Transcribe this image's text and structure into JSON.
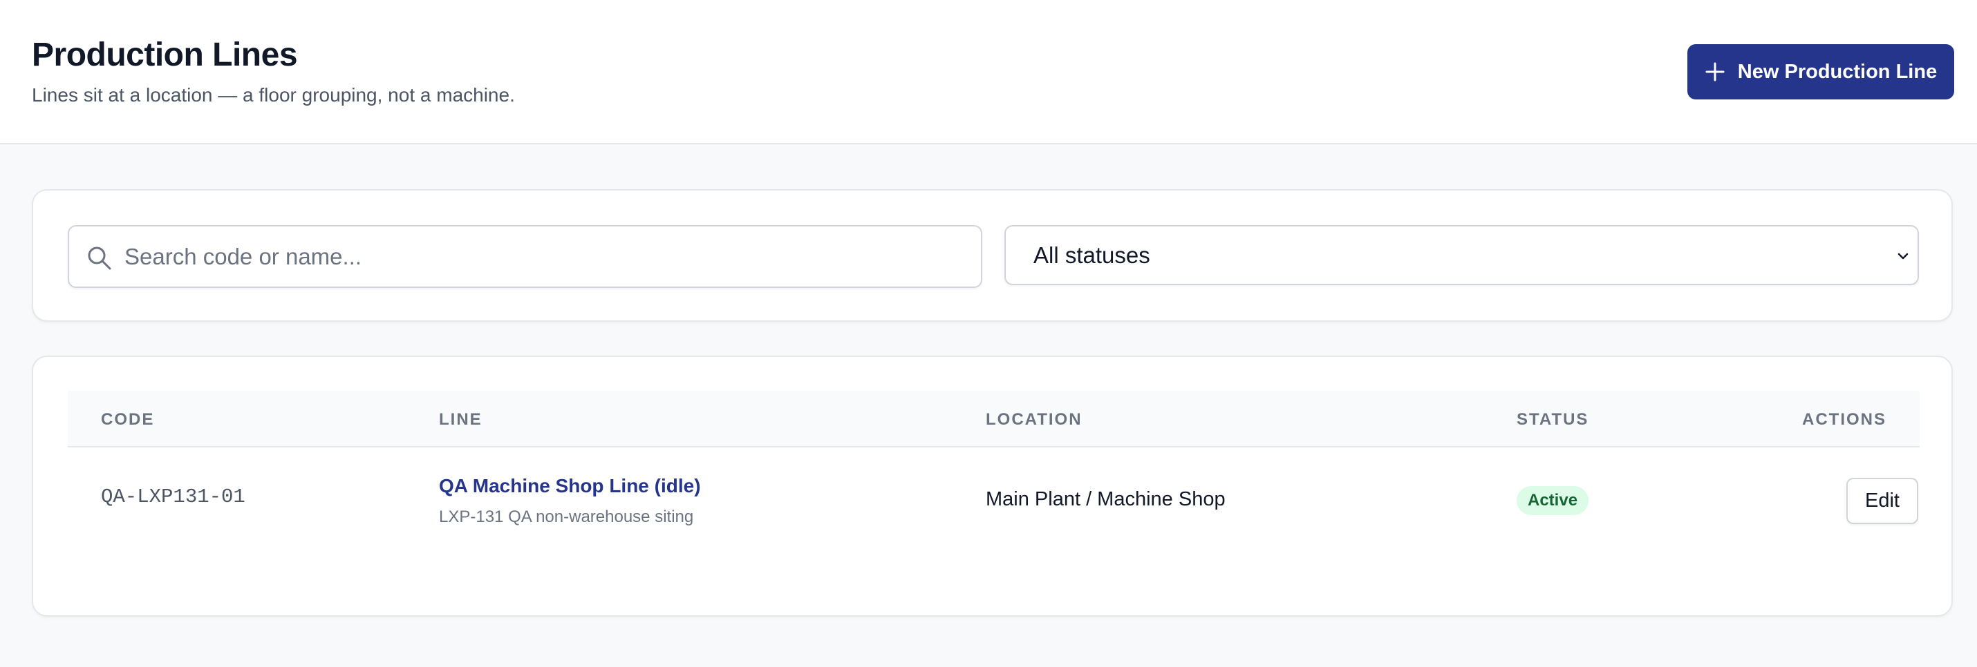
{
  "header": {
    "title": "Production Lines",
    "subtitle": "Lines sit at a location — a floor grouping, not a machine.",
    "new_button_label": "New Production Line",
    "new_button_icon": "plus-icon"
  },
  "filters": {
    "search": {
      "placeholder": "Search code or name...",
      "value": "",
      "icon": "search-icon"
    },
    "status_select": {
      "selected": "All statuses",
      "icon": "chevron-down-icon"
    }
  },
  "table": {
    "columns": [
      "CODE",
      "LINE",
      "LOCATION",
      "STATUS",
      "ACTIONS"
    ],
    "rows": [
      {
        "code": "QA-LXP131-01",
        "line_name": "QA Machine Shop Line (idle)",
        "line_description": "LXP-131 QA non-warehouse siting",
        "location": "Main Plant / Machine Shop",
        "status": "Active",
        "action_label": "Edit"
      }
    ]
  },
  "colors": {
    "primary": "#26358c",
    "active_badge_bg": "#dcfce7",
    "active_badge_text": "#166534",
    "page_bg": "#f8f9fb"
  }
}
